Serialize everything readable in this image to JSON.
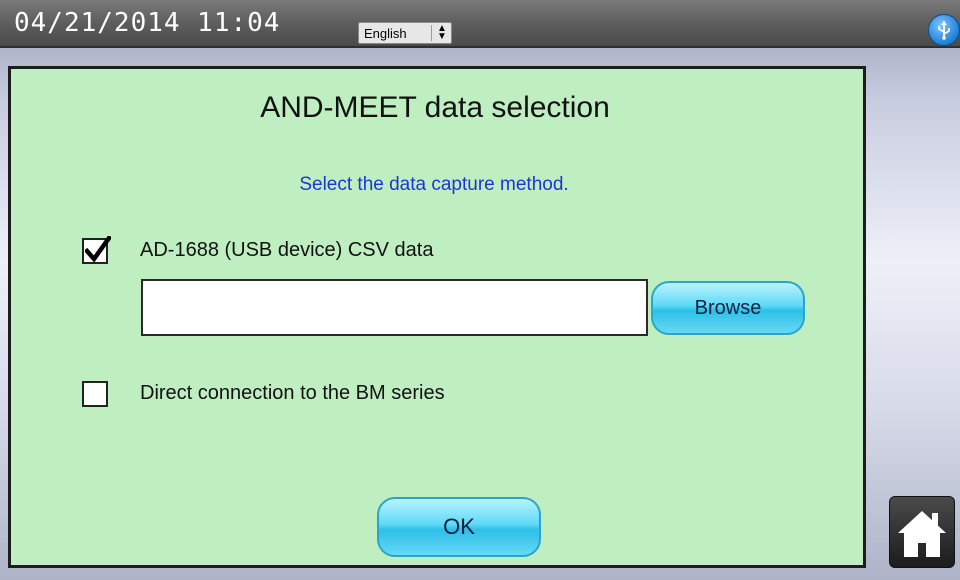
{
  "status_bar": {
    "datetime": "04/21/2014  11:04",
    "language": {
      "selected": "English",
      "arrows": "▲▼"
    },
    "usb_icon": "usb-icon"
  },
  "dialog": {
    "title": "AND-MEET data selection",
    "subtitle": "Select the data capture method.",
    "options": [
      {
        "label": "AD-1688 (USB device) CSV data",
        "checked": true
      },
      {
        "label": "Direct connection to the BM series",
        "checked": false
      }
    ],
    "file_path": {
      "value": "",
      "placeholder": ""
    },
    "browse_label": "Browse",
    "ok_label": "OK"
  },
  "colors": {
    "dialog_bg": "#bfefc0",
    "subtitle": "#1a35d8",
    "button": "#2dbfe8"
  },
  "home_icon": "home-icon"
}
